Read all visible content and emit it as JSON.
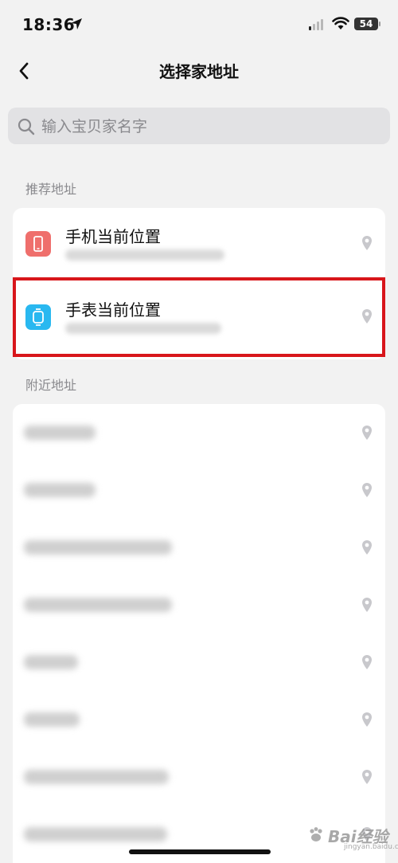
{
  "status_bar": {
    "time": "18:36",
    "battery": "54"
  },
  "nav": {
    "title": "选择家地址"
  },
  "search": {
    "placeholder": "输入宝贝家名字"
  },
  "sections": {
    "recommended_label": "推荐地址",
    "nearby_label": "附近地址"
  },
  "recommended": [
    {
      "title": "手机当前位置",
      "icon": "phone-icon",
      "icon_color": "#ef6f6c"
    },
    {
      "title": "手表当前位置",
      "icon": "watch-icon",
      "icon_color": "#29b8f0"
    }
  ],
  "highlight_color": "#d8161b",
  "nearby_count_visible": 7,
  "watermark": {
    "text": "Bai经验",
    "sub": "jingyan.baidu.com"
  }
}
